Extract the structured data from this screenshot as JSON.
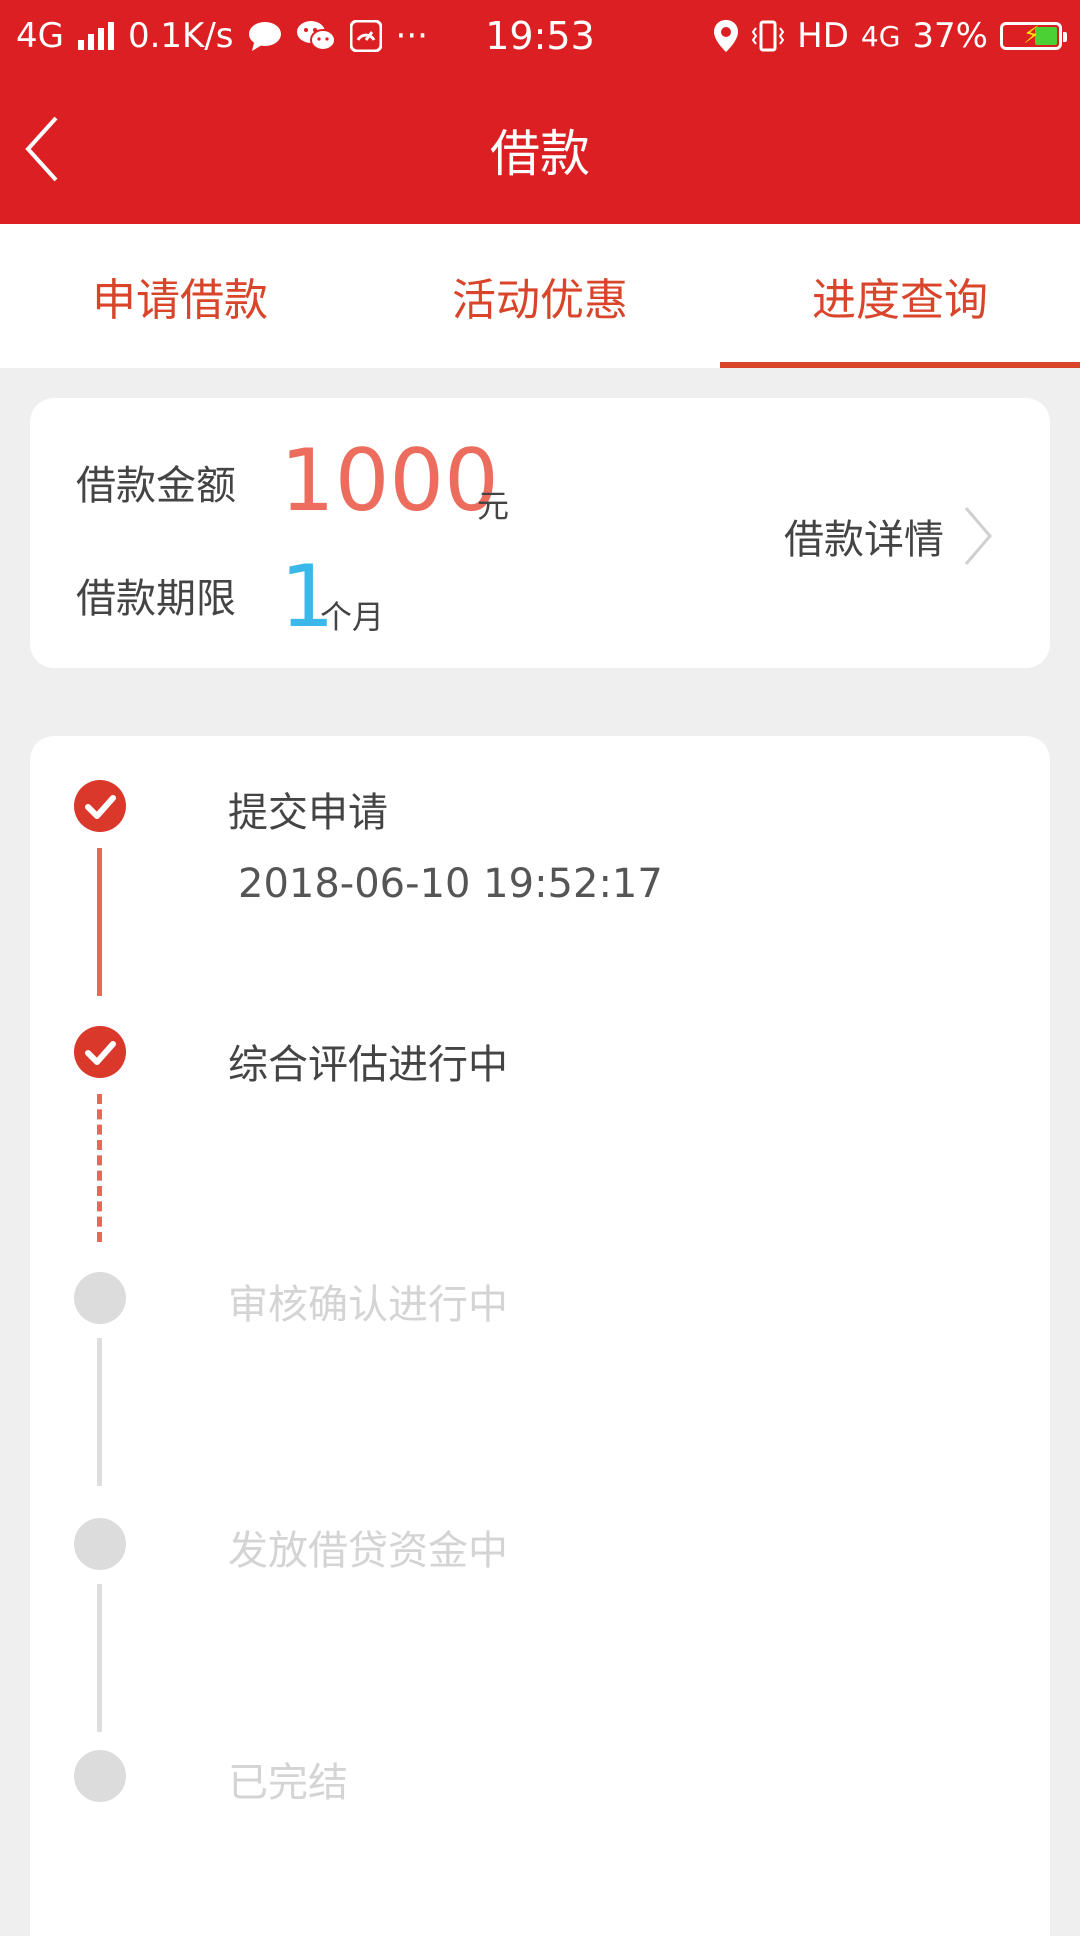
{
  "status_bar": {
    "network": "4G",
    "speed": "0.1K/s",
    "time": "19:53",
    "hd": "HD",
    "network_right": "4G",
    "battery": "37%",
    "more": "···"
  },
  "header": {
    "title": "借款"
  },
  "tabs": [
    {
      "label": "申请借款",
      "active": false
    },
    {
      "label": "活动优惠",
      "active": false
    },
    {
      "label": "进度查询",
      "active": true
    }
  ],
  "summary": {
    "amount_label": "借款金额",
    "amount_value": "1000",
    "amount_unit": "元",
    "term_label": "借款期限",
    "term_value": "1",
    "term_unit": "个月",
    "detail_link": "借款详情"
  },
  "progress": {
    "steps": [
      {
        "label": "提交申请",
        "time": "2018-06-10 19:52:17",
        "status": "done"
      },
      {
        "label": "综合评估进行中",
        "status": "done"
      },
      {
        "label": "审核确认进行中",
        "status": "pending"
      },
      {
        "label": "发放借贷资金中",
        "status": "pending"
      },
      {
        "label": "已完结",
        "status": "pending"
      }
    ]
  },
  "colors": {
    "brand_red": "#dc1f22",
    "accent": "#d9452a",
    "amount": "#ec6d5d",
    "term": "#3bb8ea",
    "pending": "#dcdcdc"
  }
}
